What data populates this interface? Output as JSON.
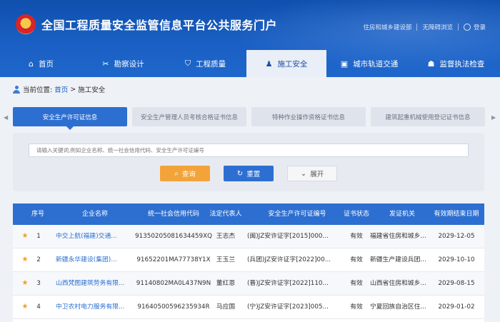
{
  "header": {
    "title": "全国工程质量安全监管信息平台公共服务门户",
    "links": [
      "住房和城乡建设部",
      "无障碍浏览",
      "登录"
    ]
  },
  "nav": [
    {
      "label": "首页",
      "icon": "home-icon",
      "glyph": "⌂",
      "active": false
    },
    {
      "label": "勘察设计",
      "icon": "tools-icon",
      "glyph": "✂",
      "active": false
    },
    {
      "label": "工程质量",
      "icon": "shield-icon",
      "glyph": "⛉",
      "active": false
    },
    {
      "label": "施工安全",
      "icon": "worker-icon",
      "glyph": "♟",
      "active": true
    },
    {
      "label": "城市轨道交通",
      "icon": "train-icon",
      "glyph": "▣",
      "active": false
    },
    {
      "label": "监督执法检查",
      "icon": "inspector-icon",
      "glyph": "☗",
      "active": false
    }
  ],
  "breadcrumb": {
    "prefix": "当前位置:",
    "home": "首页",
    "separator": ">",
    "current": "施工安全"
  },
  "tabs": [
    {
      "label": "安全生产许可证信息",
      "active": true
    },
    {
      "label": "安全生产管理人员考核合格证书信息",
      "active": false
    },
    {
      "label": "特种作业操作资格证书信息",
      "active": false
    },
    {
      "label": "建筑起重机械使用登记证书信息",
      "active": false
    }
  ],
  "search": {
    "placeholder": "请输入关键词,例如企业名称、统一社会信用代码、安全生产许可证编号",
    "query_label": "查询",
    "reset_label": "重置",
    "expand_label": "展开"
  },
  "table": {
    "columns": [
      "序号",
      "企业名称",
      "统一社会信用代码",
      "法定代表人",
      "安全生产许可证编号",
      "证书状态",
      "发证机关",
      "有效期结束日期"
    ],
    "rows": [
      {
        "no": "1",
        "name": "中交上航(福建)交通...",
        "code": "91350205081634459XQ",
        "rep": "王志杰",
        "license": "(闽)JZ安许证字[2015]000...",
        "status": "有效",
        "issuer": "福建省住房和城乡...",
        "end": "2029-12-05"
      },
      {
        "no": "2",
        "name": "新疆永华建设(集团)...",
        "code": "91652201MA77738Y1X",
        "rep": "王玉兰",
        "license": "(兵团)JZ安许证字[2022]00...",
        "status": "有效",
        "issuer": "新疆生产建设兵团...",
        "end": "2029-10-10"
      },
      {
        "no": "3",
        "name": "山西梵图建筑劳务有限...",
        "code": "91140802MA0L437N9N",
        "rep": "董红恩",
        "license": "(晋)JZ安许证字[2022]110...",
        "status": "有效",
        "issuer": "山西省住房和城乡...",
        "end": "2029-08-15"
      },
      {
        "no": "4",
        "name": "中卫农村电力服务有限...",
        "code": "91640500596235934R",
        "rep": "马应国",
        "license": "(宁)JZ安许证字[2023]005...",
        "status": "有效",
        "issuer": "宁夏回族自治区住...",
        "end": "2029-01-02"
      }
    ]
  },
  "colors": {
    "header": "#1a5fc3",
    "accent": "#2d6fd1",
    "query": "#f2a43a",
    "star": "#f0a020"
  }
}
